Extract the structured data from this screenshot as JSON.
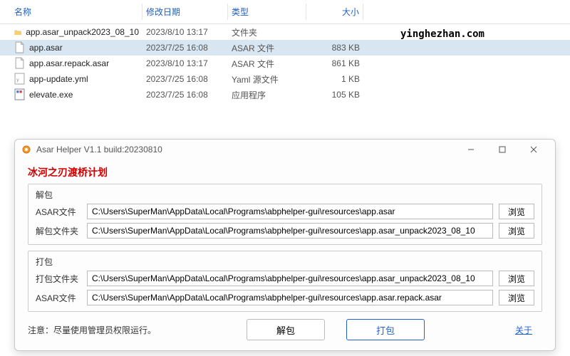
{
  "file_list": {
    "headers": {
      "name": "名称",
      "date": "修改日期",
      "type": "类型",
      "size": "大小"
    },
    "rows": [
      {
        "icon": "folder",
        "name": "app.asar_unpack2023_08_10",
        "date": "2023/8/10 13:17",
        "type": "文件夹",
        "size": "",
        "selected": false
      },
      {
        "icon": "file",
        "name": "app.asar",
        "date": "2023/7/25 16:08",
        "type": "ASAR 文件",
        "size": "883 KB",
        "selected": true
      },
      {
        "icon": "file",
        "name": "app.asar.repack.asar",
        "date": "2023/8/10 13:17",
        "type": "ASAR 文件",
        "size": "861 KB",
        "selected": false
      },
      {
        "icon": "yml",
        "name": "app-update.yml",
        "date": "2023/7/25 16:08",
        "type": "Yaml 源文件",
        "size": "1 KB",
        "selected": false
      },
      {
        "icon": "exe",
        "name": "elevate.exe",
        "date": "2023/7/25 16:08",
        "type": "应用程序",
        "size": "105 KB",
        "selected": false
      }
    ]
  },
  "watermark": "yinghezhan.com",
  "dialog": {
    "title": "Asar Helper V1.1 build:20230810",
    "red_title": "冰河之刃渡桥计划",
    "unpack": {
      "group_label": "解包",
      "asar_label": "ASAR文件",
      "asar_value": "C:\\Users\\SuperMan\\AppData\\Local\\Programs\\abphelper-gui\\resources\\app.asar",
      "folder_label": "解包文件夹",
      "folder_value": "C:\\Users\\SuperMan\\AppData\\Local\\Programs\\abphelper-gui\\resources\\app.asar_unpack2023_08_10",
      "browse": "浏览"
    },
    "pack": {
      "group_label": "打包",
      "folder_label": "打包文件夹",
      "folder_value": "C:\\Users\\SuperMan\\AppData\\Local\\Programs\\abphelper-gui\\resources\\app.asar_unpack2023_08_10",
      "asar_label": "ASAR文件",
      "asar_value": "C:\\Users\\SuperMan\\AppData\\Local\\Programs\\abphelper-gui\\resources\\app.asar.repack.asar",
      "browse": "浏览"
    },
    "note": "注意：尽量使用管理员权限运行。",
    "btn_unpack": "解包",
    "btn_pack": "打包",
    "about": "关于"
  }
}
